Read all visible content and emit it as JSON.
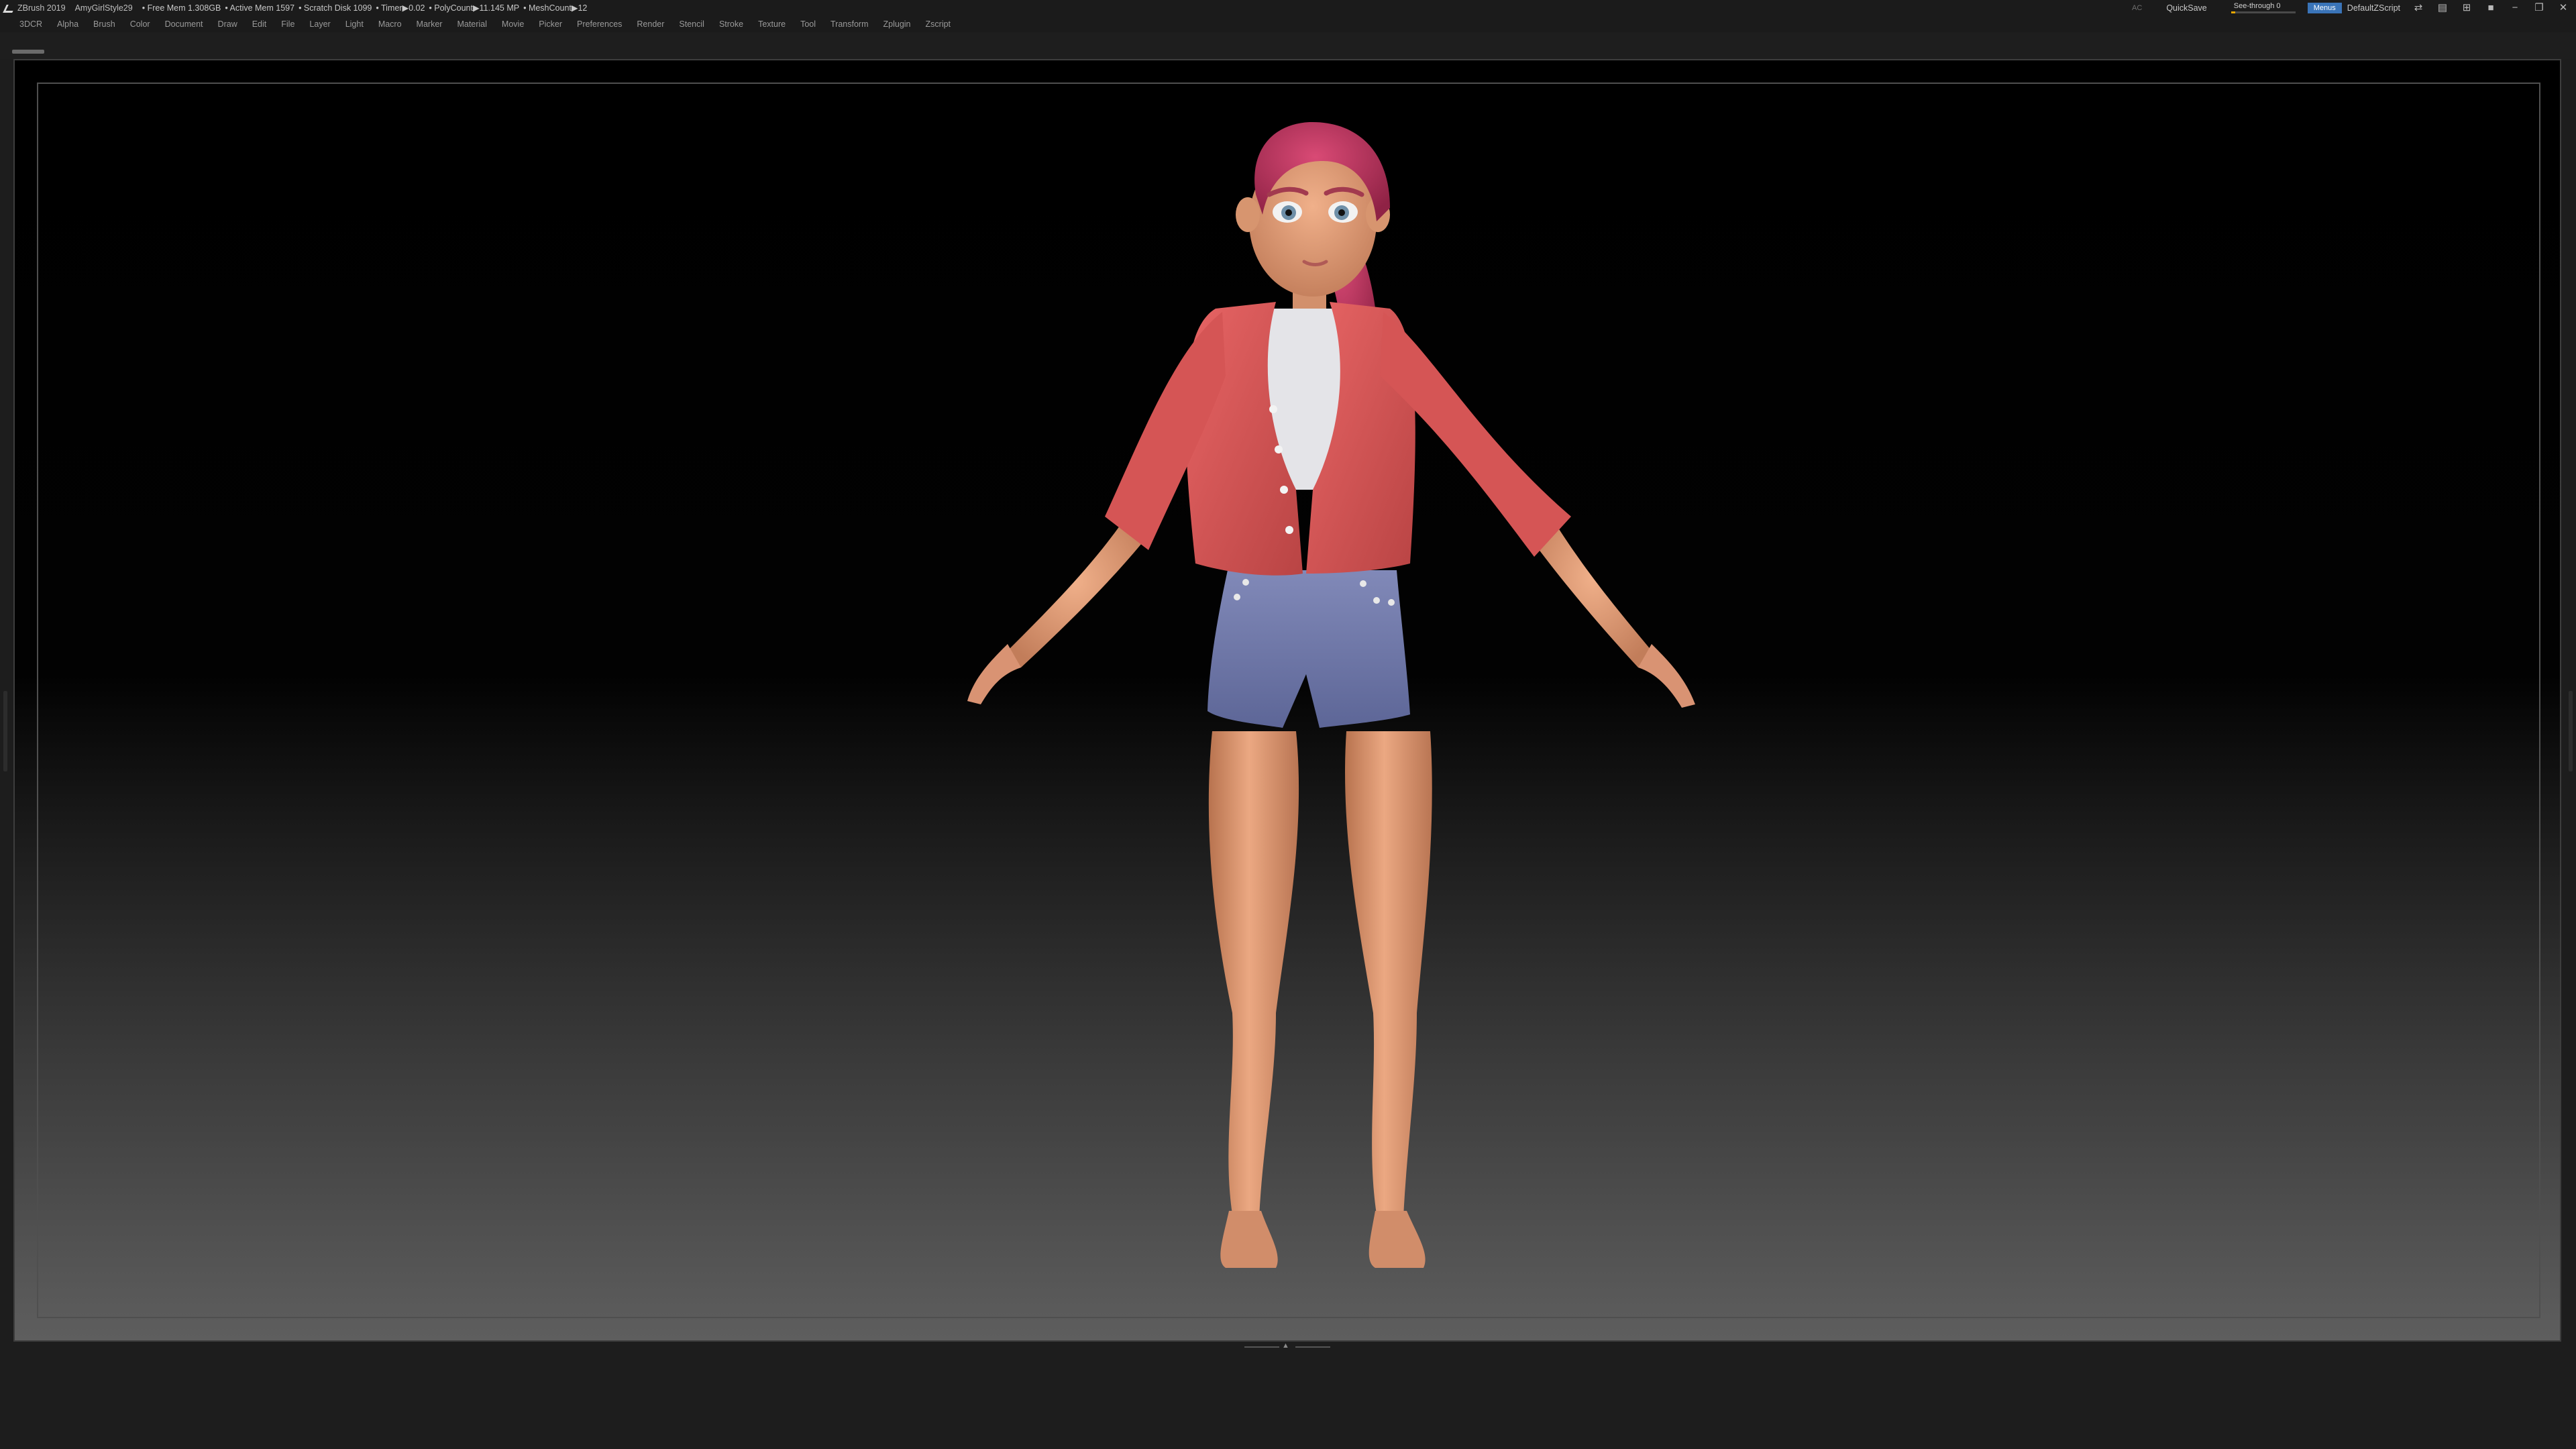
{
  "titlebar": {
    "app": "ZBrush 2019",
    "project": "AmyGirlStyle29",
    "free_mem": "• Free Mem 1.308GB",
    "active_mem": "• Active Mem 1597",
    "scratch_disk": "• Scratch Disk 1099",
    "timer": "• Timer▶0.02",
    "polycount": "• PolyCount▶11.145 MP",
    "meshcount": "• MeshCount▶12",
    "ac_label": "AC",
    "quicksave": "QuickSave",
    "seethrough": "See-through 0",
    "seethrough_level": 0,
    "menus_label": "Menus",
    "script_label": "DefaultZScript"
  },
  "menu": [
    "3DCR",
    "Alpha",
    "Brush",
    "Color",
    "Document",
    "Draw",
    "Edit",
    "File",
    "Layer",
    "Light",
    "Macro",
    "Marker",
    "Material",
    "Movie",
    "Picker",
    "Preferences",
    "Render",
    "Stencil",
    "Stroke",
    "Texture",
    "Tool",
    "Transform",
    "Zplugin",
    "Zscript"
  ],
  "colors": {
    "accent": "#3a74b8",
    "slider_fill": "#e6a600",
    "jacket": "#e25e5e",
    "shorts": "#7580b0",
    "hair": "#c23a62",
    "skin": "#e6a07a"
  },
  "icons": {
    "app": "zbrush-logo-icon",
    "window": [
      "layout-icon",
      "palette-icon",
      "help-icon",
      "lock-icon",
      "minimize-icon",
      "restore-icon",
      "close-icon"
    ]
  }
}
